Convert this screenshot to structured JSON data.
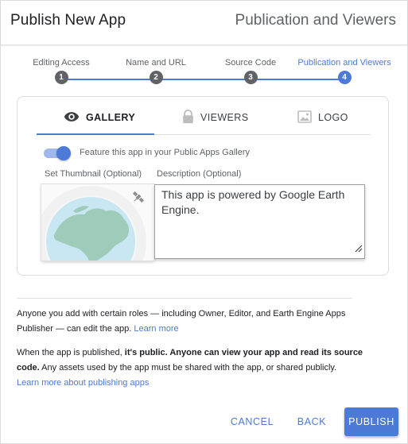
{
  "header": {
    "title": "Publish New App",
    "subtitle": "Publication and Viewers"
  },
  "stepper": {
    "steps": [
      {
        "label": "Editing Access",
        "number": "1"
      },
      {
        "label": "Name and URL",
        "number": "2"
      },
      {
        "label": "Source Code",
        "number": "3"
      },
      {
        "label": "Publication and Viewers",
        "number": "4"
      }
    ],
    "active_step": 4
  },
  "tabs": [
    {
      "label": "GALLERY",
      "icon": "eye-icon"
    },
    {
      "label": "VIEWERS",
      "icon": "lock-icon"
    },
    {
      "label": "LOGO",
      "icon": "image-icon"
    }
  ],
  "gallery": {
    "toggle_on": true,
    "toggle_label": "Feature this app in your Public Apps Gallery",
    "thumbnail_label": "Set Thumbnail (Optional)",
    "description_label": "Description (Optional)",
    "description_value": "This app is powered by Google Earth Engine."
  },
  "info": {
    "p1_text": "Anyone you add with certain roles — including Owner, Editor, and Earth Engine Apps Publisher — can edit the app.",
    "p1_link": "Learn more",
    "p2_pre": "When the app is published, ",
    "p2_bold": "it's public. Anyone can view your app and read its source code.",
    "p2_post": " Any assets used by the app must be shared with the app, or shared publicly.",
    "p2_link": "Learn more about publishing apps"
  },
  "buttons": {
    "cancel": "CANCEL",
    "back": "BACK",
    "publish": "PUBLISH"
  },
  "colors": {
    "accent": "#4c7ad6",
    "inactive_step": "#5f6368"
  }
}
